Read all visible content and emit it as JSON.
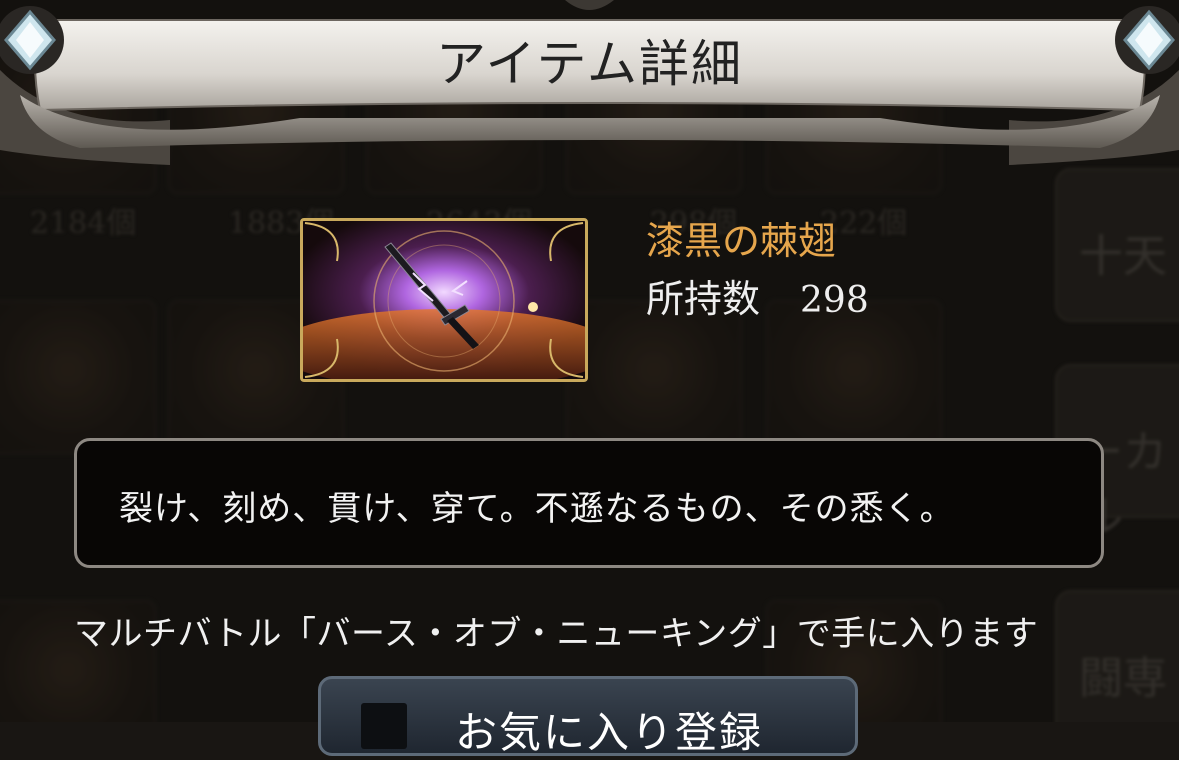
{
  "header": {
    "title": "アイテム詳細"
  },
  "background": {
    "counts": [
      "2184個",
      "1883個",
      "2643個",
      "298個",
      "222個"
    ],
    "side_tabs": [
      "十天",
      "ーカル",
      "闘専"
    ]
  },
  "item": {
    "name": "漆黒の棘翅",
    "owned_label": "所持数",
    "owned_count": "298",
    "icon": "black-sword-item-icon",
    "description": "裂け、刻め、貫け、穿て。不遜なるもの、その悉く。",
    "source": "マルチバトル「バース・オブ・ニューキング」で手に入ります"
  },
  "actions": {
    "favorite_label": "お気に入り登録"
  },
  "colors": {
    "item_name": "#e6a64c",
    "frame_gold": "#c9a95c",
    "banner": "#e4e1dc"
  }
}
